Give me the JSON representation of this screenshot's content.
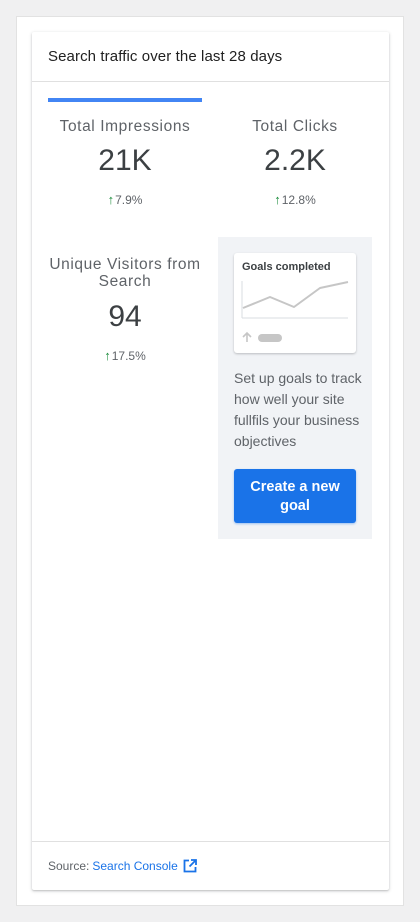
{
  "widget": {
    "title": "Search traffic over the last 28 days"
  },
  "metrics": [
    {
      "label": "Total Impressions",
      "value": "21K",
      "change": "7.9%",
      "change_direction": "up",
      "selected": true
    },
    {
      "label": "Total Clicks",
      "value": "2.2K",
      "change": "12.8%",
      "change_direction": "up",
      "selected": false
    },
    {
      "label": "Unique Visitors from Search",
      "value": "94",
      "change": "17.5%",
      "change_direction": "up",
      "selected": false
    }
  ],
  "goal_cta": {
    "thumb_title": "Goals completed",
    "description": "Set up goals to track how well your site fullfils your business objectives",
    "button_label": "Create a new goal"
  },
  "footer": {
    "source_label": "Source:",
    "source_link": "Search Console",
    "link_icon": "external-link-icon"
  },
  "colors": {
    "accent": "#4285f4",
    "button": "#1a73e8",
    "positive": "#1e8e3e"
  }
}
